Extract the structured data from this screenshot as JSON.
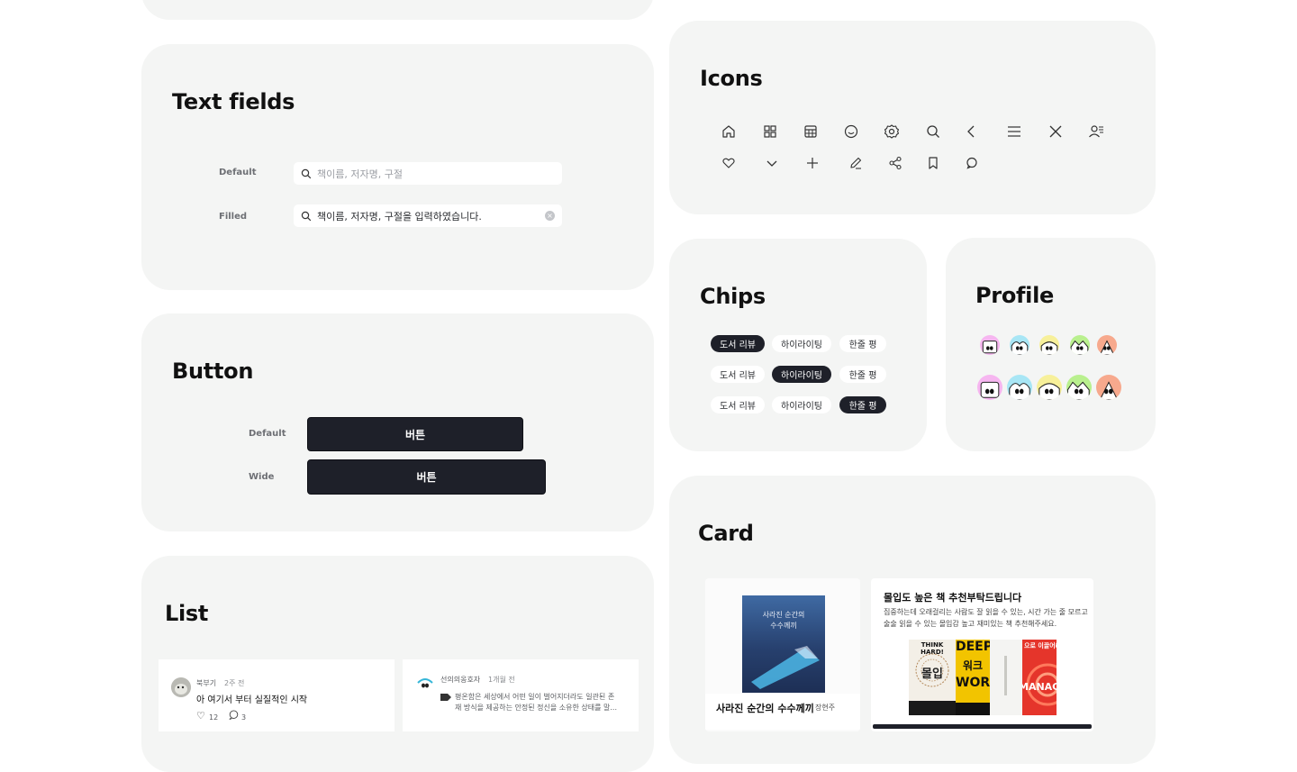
{
  "text_fields": {
    "title": "Text fields",
    "default_label": "Default",
    "filled_label": "Filled",
    "default_placeholder": "책이름, 저자명, 구절",
    "filled_value": "책이름, 저자명, 구절을 입력하였습니다."
  },
  "button": {
    "title": "Button",
    "default_label": "Default",
    "wide_label": "Wide",
    "default_text": "버튼",
    "wide_text": "버튼"
  },
  "list": {
    "title": "List",
    "items": [
      {
        "author": "북부기",
        "time": "2주 전",
        "title": "아 여기서 부터 실질적인 시작",
        "likes": "12",
        "comments": "3"
      },
      {
        "author": "선의의옹호자",
        "time": "1개월 전",
        "quote_line1": "평온함은 세상에서 어떤 일이 벌어지더라도 일관된 존",
        "quote_line2": "재 방식을 제공하는 안정된 정신을 소유한 상태를 말..."
      }
    ]
  },
  "icons": {
    "title": "Icons",
    "row1": [
      "home-icon",
      "grid-icon",
      "calendar-icon",
      "smile-icon",
      "settings-icon",
      "search-icon",
      "chevron-left-icon",
      "menu-icon",
      "close-icon",
      "user-list-icon"
    ],
    "row2": [
      "heart-icon",
      "chevron-down-icon",
      "plus-icon",
      "pencil-icon",
      "share-icon",
      "bookmark-icon",
      "chat-icon"
    ]
  },
  "chips": {
    "title": "Chips",
    "labels": [
      "도서 리뷰",
      "하이라이팅",
      "한줄 평"
    ],
    "rows": [
      {
        "active": 0
      },
      {
        "active": 1
      },
      {
        "active": 2
      }
    ]
  },
  "profile": {
    "title": "Profile",
    "colors": [
      "#f6b6f0",
      "#a8e6f5",
      "#f7f09a",
      "#b9f08e",
      "#f7a98d"
    ]
  },
  "card": {
    "title": "Card",
    "book": {
      "cover_title_line1": "사라진 순간의",
      "cover_title_line2": "수수께끼",
      "title": "사라진 순간의 수수께끼",
      "author": "장현주"
    },
    "post": {
      "title": "몰입도 높은 책 추천부탁드립니다",
      "body_line1": "집중하는데 오래걸리는 사람도 잘 읽을 수 있는, 시간 가는 줄 모르고",
      "body_line2": "술술 읽을 수 있는 몰입감 높고 재미있는 책 추천해주세요.",
      "books": [
        "THINK HARD!",
        "몰입",
        "DEEP",
        "워크",
        "WORK",
        "으로 이끌어라",
        "MANAGER"
      ]
    }
  }
}
